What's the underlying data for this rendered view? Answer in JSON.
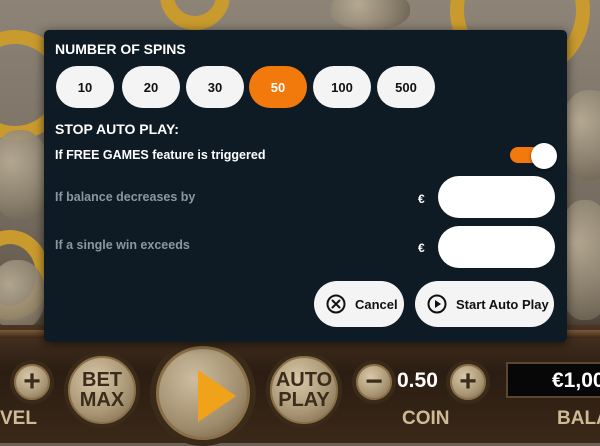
{
  "dialog": {
    "spins_title": "NUMBER OF SPINS",
    "spin_options": [
      "10",
      "20",
      "30",
      "50",
      "100",
      "500"
    ],
    "selected_spins": "50",
    "stop_title": "STOP AUTO PLAY:",
    "free_games_label": "If FREE GAMES feature is triggered",
    "free_games_toggle_on": true,
    "balance_label": "If balance decreases by",
    "balance_currency": "€",
    "balance_value": "",
    "win_label": "If a single win exceeds",
    "win_currency": "€",
    "win_value": "",
    "cancel_label": "Cancel",
    "start_label": "Start Auto Play"
  },
  "game_bar": {
    "bet_max_line1": "BET",
    "bet_max_line2": "MAX",
    "auto_play_line1": "AUTO",
    "auto_play_line2": "PLAY",
    "plus_symbol": "+",
    "minus_symbol": "−",
    "coin_value": "0.50",
    "coin_label": "COIN",
    "level_label": "VEL",
    "balance_value": "€1,00",
    "balance_label": "BALA"
  },
  "colors": {
    "accent": "#f27a0c",
    "modal_bg": "#0f1b24",
    "button_bg": "#f4f4f4",
    "muted_text": "#8c969f"
  },
  "icons": {
    "cancel": "circle-x-icon",
    "start": "circle-play-icon"
  }
}
